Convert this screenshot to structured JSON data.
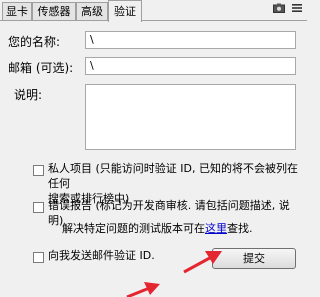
{
  "tabs": [
    {
      "label": "显卡"
    },
    {
      "label": "传感器"
    },
    {
      "label": "高级"
    },
    {
      "label": "验证",
      "active": true
    }
  ],
  "form": {
    "name_label": "您的名称:",
    "name_value": "\\",
    "email_label": "邮箱 (可选):",
    "email_value": "\\",
    "desc_label": "说明:"
  },
  "options": {
    "private_label_1": "私人项目 (只能访问时验证 ID, 已知的将不会被列在任何",
    "private_label_2": "搜索或排行榜中)",
    "bug_label": "错误报告 (标记为开发商审核. 请包括问题描述, 说明)",
    "fix_prefix": "解决特定问题的测试版本可在",
    "fix_link": "这里",
    "fix_suffix": "查找.",
    "send_email_label": "向我发送邮件验证 ID."
  },
  "submit_label": "提交",
  "colors": {
    "arrow": "#e3262f"
  }
}
